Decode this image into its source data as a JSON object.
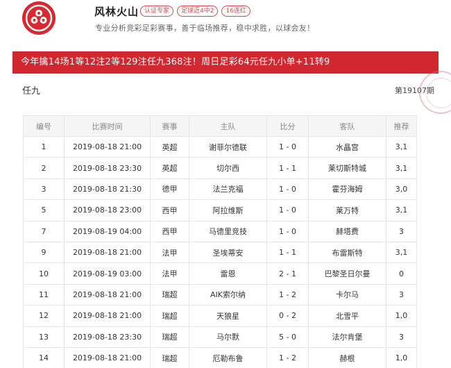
{
  "profile": {
    "name": "风林火山",
    "tags": [
      "认证专家",
      "足球近4中2",
      "16连红"
    ],
    "description": "专业分析竞彩足彩赛事，善于临场推荐，稳中求胜，以球会友！"
  },
  "banner": "今年擒14场1等12注2等129注任九368注！周日足彩64元任九小单+11转9",
  "section": {
    "title": "任九",
    "period": "第19107期"
  },
  "table": {
    "headers": [
      "编号",
      "比赛时间",
      "赛事",
      "主队",
      "比分",
      "客队",
      "推荐"
    ],
    "rows": [
      {
        "no": "1",
        "time": "2019-08-18 21:00",
        "league": "英超",
        "home": "谢菲尔德联",
        "score": "1 - 0",
        "away": "水晶宫",
        "pick": "3,1"
      },
      {
        "no": "2",
        "time": "2019-08-18 23:30",
        "league": "英超",
        "home": "切尔西",
        "score": "1 - 1",
        "away": "莱切斯特城",
        "pick": "3,1"
      },
      {
        "no": "3",
        "time": "2019-08-18 21:30",
        "league": "德甲",
        "home": "法兰克福",
        "score": "1 - 0",
        "away": "霍芬海姆",
        "pick": "3,0"
      },
      {
        "no": "5",
        "time": "2019-08-18 23:00",
        "league": "西甲",
        "home": "阿拉维斯",
        "score": "1 - 0",
        "away": "莱万特",
        "pick": "3,1"
      },
      {
        "no": "7",
        "time": "2019-08-19 04:00",
        "league": "西甲",
        "home": "马德里竞技",
        "score": "1 - 0",
        "away": "赫塔费",
        "pick": "3"
      },
      {
        "no": "9",
        "time": "2019-08-18 21:00",
        "league": "法甲",
        "home": "圣埃蒂安",
        "score": "1 - 1",
        "away": "布雷斯特",
        "pick": "3,1"
      },
      {
        "no": "10",
        "time": "2019-08-19 03:00",
        "league": "法甲",
        "home": "雷恩",
        "score": "2 - 1",
        "away": "巴黎圣日尔曼",
        "pick": "0"
      },
      {
        "no": "11",
        "time": "2019-08-18 21:00",
        "league": "瑞超",
        "home": "AIK索尔纳",
        "score": "1 - 2",
        "away": "卡尔马",
        "pick": "3"
      },
      {
        "no": "12",
        "time": "2019-08-18 21:00",
        "league": "瑞超",
        "home": "天狼星",
        "score": "0 - 2",
        "away": "北雪平",
        "pick": "1,0"
      },
      {
        "no": "13",
        "time": "2019-08-18 23:30",
        "league": "瑞超",
        "home": "马尔默",
        "score": "5 - 0",
        "away": "法尔肯堡",
        "pick": "3"
      },
      {
        "no": "14",
        "time": "2019-08-18 21:00",
        "league": "瑞超",
        "home": "厄勒布鲁",
        "score": "1 - 2",
        "away": "赫根",
        "pick": "1,0"
      }
    ]
  },
  "colors": {
    "accent": "#d1282f",
    "header_bg": "#f5f5f5",
    "border": "#e6e6e6"
  }
}
